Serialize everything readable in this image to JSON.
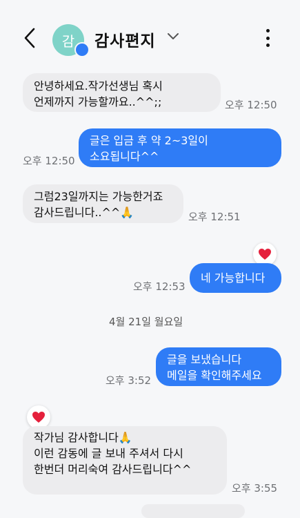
{
  "header": {
    "contact_name": "감사편지",
    "avatar_text": "감",
    "accent": "#2f7cf6"
  },
  "messages": [
    {
      "id": "m1",
      "side": "in",
      "text": "안녕하세요.작가선생님 혹시\n언제까지 가능할까요..^^;;",
      "time": "오후 12:50"
    },
    {
      "id": "m2",
      "side": "out",
      "text": "글은 입금  후 약 2~3일이\n소요됩니다^^",
      "time": "오후 12:50"
    },
    {
      "id": "m3",
      "side": "in",
      "text": "그럼23일까지는 가능한거죠\n감사드립니다..^^🙏",
      "time": "오후 12:51"
    },
    {
      "id": "m4",
      "side": "out",
      "text": "네 가능합니다",
      "time": "오후 12:53",
      "reaction": "heart"
    },
    {
      "id": "m5",
      "side": "out",
      "text": "글을 보냈습니다\n메일을 확인해주세요",
      "time": "오후 3:52"
    },
    {
      "id": "m6",
      "side": "in",
      "text": "작가님  감사합니다🙏\n이런  감동에 글 보내 주셔서 다시\n한번더 머리숙여 감사드립니다^^",
      "time": "오후 3:55",
      "reaction": "heart"
    }
  ],
  "date_divider": "4월 21일 월요일",
  "icons": {
    "back": "chevron-left-icon",
    "dropdown": "chevron-down-icon",
    "more": "more-vertical-icon",
    "reaction": "heart-icon"
  }
}
